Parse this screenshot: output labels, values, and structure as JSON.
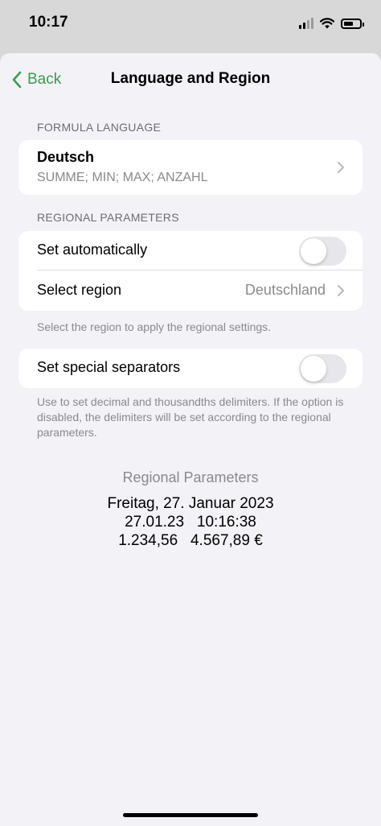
{
  "status_bar": {
    "time": "10:17"
  },
  "nav": {
    "back_label": "Back",
    "title": "Language and Region"
  },
  "formula_section": {
    "header": "FORMULA LANGUAGE",
    "language": "Deutsch",
    "functions": "SUMME; MIN; MAX; ANZAHL"
  },
  "regional_section": {
    "header": "REGIONAL PARAMETERS",
    "set_automatically_label": "Set automatically",
    "set_automatically_on": false,
    "select_region_label": "Select region",
    "select_region_value": "Deutschland",
    "footnote": "Select the region to apply the regional settings."
  },
  "separators_section": {
    "label": "Set special separators",
    "enabled": false,
    "footnote": "Use to set decimal and thousandths delimiters. If the option is disabled, the delimiters will be set according to the regional parameters."
  },
  "preview": {
    "title": "Regional Parameters",
    "long_date": "Freitag, 27. Januar 2023",
    "short_datetime": "27.01.23   10:16:38",
    "numbers": "1.234,56   4.567,89 €"
  },
  "colors": {
    "accent": "#3e9b4f",
    "background": "#f2f2f7",
    "toggle_off": "#e6e6eb"
  }
}
